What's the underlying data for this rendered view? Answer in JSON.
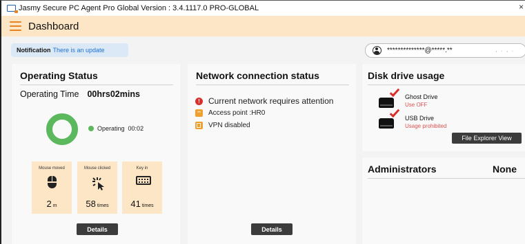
{
  "window": {
    "title": "Jasmy Secure PC Agent Pro Global Version : 3.4.1117.0 PRO-GLOBAL",
    "close_glyph": "×"
  },
  "header": {
    "title": "Dashboard"
  },
  "notification": {
    "label": "Notification",
    "message": "There is an update"
  },
  "user": {
    "email": "**************@*****.**",
    "extra": ",  .  ,  ."
  },
  "operating_status": {
    "title": "Operating Status",
    "time_label": "Operating Time",
    "time_value": "00hrs02mins",
    "status_label": "Operating",
    "status_time": "00:02",
    "status_color": "#5cb85c",
    "stats": [
      {
        "label": "Mouse moved",
        "value": "2",
        "unit": "m",
        "icon": "mouse-icon"
      },
      {
        "label": "Mouse clicked",
        "value": "58",
        "unit": "times",
        "icon": "cursor-click-icon"
      },
      {
        "label": "Key in",
        "value": "41",
        "unit": "times",
        "icon": "keyboard-icon"
      }
    ],
    "details_label": "Details"
  },
  "network": {
    "title": "Network connection status",
    "items": [
      {
        "text": "Current network requires attention",
        "icon": "warning-icon"
      },
      {
        "text": "Access point :HR0",
        "icon": "wifi-icon"
      },
      {
        "text": "VPN disabled",
        "icon": "vpn-icon"
      }
    ],
    "details_label": "Details"
  },
  "disk": {
    "title": "Disk drive usage",
    "drives": [
      {
        "name": "Ghost Drive",
        "status": "Use OFF"
      },
      {
        "name": "USB Drive",
        "status": "Usage prohibited"
      }
    ],
    "explorer_label": "File Explorer View"
  },
  "administrators": {
    "title": "Administrators",
    "value": "None"
  },
  "colors": {
    "accent_orange": "#e8821e",
    "header_bg": "#fde6c6",
    "warning_red": "#d9302c",
    "link_blue": "#1f6fd6"
  }
}
